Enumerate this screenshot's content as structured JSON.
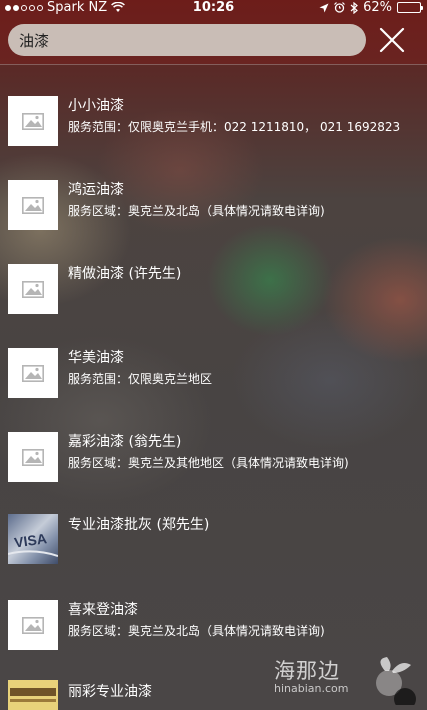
{
  "status_bar": {
    "carrier": "Spark NZ",
    "time": "10:26",
    "battery_percent": "62%",
    "battery_level": 0.62
  },
  "search": {
    "query": "油漆"
  },
  "results": [
    {
      "title": "小小油漆",
      "description": "服务范围：仅限奥克兰手机：022 1211810，  021 1692823",
      "thumbnail": "placeholder-image"
    },
    {
      "title": "鸿运油漆",
      "description": "服务区域：奥克兰及北岛（具体情况请致电详询)",
      "thumbnail": "placeholder-image"
    },
    {
      "title": "精做油漆 (许先生)",
      "description": "",
      "thumbnail": "placeholder-image"
    },
    {
      "title": "华美油漆",
      "description": "服务范围：仅限奥克兰地区",
      "thumbnail": "placeholder-image"
    },
    {
      "title": "嘉彩油漆 (翁先生)",
      "description": "服务区域：奥克兰及其他地区（具体情况请致电详询)",
      "thumbnail": "placeholder-image"
    },
    {
      "title": "专业油漆批灰 (郑先生)",
      "description": "",
      "thumbnail": "visa-photo"
    },
    {
      "title": "喜来登油漆",
      "description": "服务区域：奥克兰及北岛（具体情况请致电详询)",
      "thumbnail": "placeholder-image"
    },
    {
      "title": "丽彩专业油漆",
      "description": "",
      "thumbnail": "sign-photo"
    }
  ],
  "watermark": {
    "main": "海那边",
    "sub": "hinabian.com"
  },
  "colors": {
    "header": "#6d1d1a",
    "search_field": "#c9bdb6",
    "text": "#ffffff"
  }
}
